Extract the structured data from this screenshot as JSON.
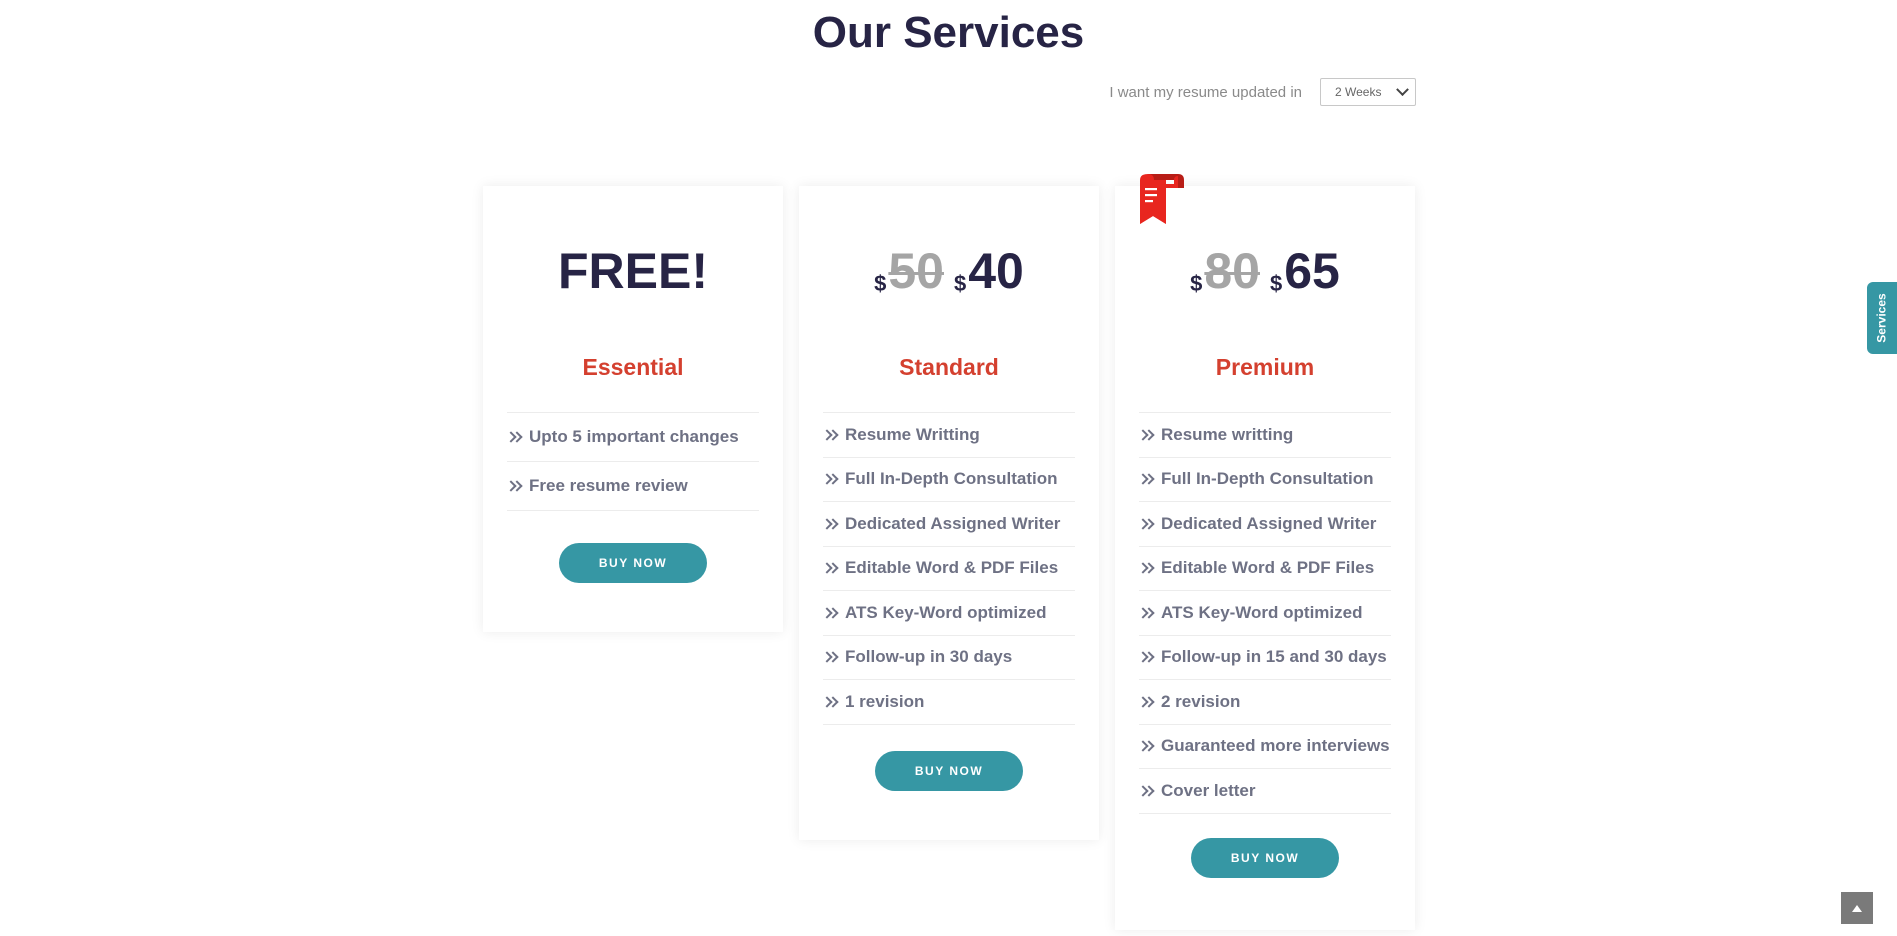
{
  "header": {
    "title": "Our Services"
  },
  "duration": {
    "label": "I want my resume updated in",
    "selected": "2 Weeks"
  },
  "plans": [
    {
      "name": "Essential",
      "price_text": "FREE!",
      "features": [
        "Upto 5 important changes",
        "Free resume review"
      ],
      "button": "BUY NOW"
    },
    {
      "name": "Standard",
      "currency": "$",
      "old_price": "50",
      "price": "40",
      "features": [
        "Resume Writting",
        "Full In-Depth Consultation",
        "Dedicated Assigned Writer",
        "Editable Word & PDF Files",
        "ATS Key-Word optimized",
        "Follow-up in 30 days",
        "1 revision"
      ],
      "button": "BUY NOW"
    },
    {
      "name": "Premium",
      "currency": "$",
      "old_price": "80",
      "price": "65",
      "features": [
        "Resume writting",
        "Full In-Depth Consultation",
        "Dedicated Assigned Writer",
        "Editable Word & PDF Files",
        "ATS Key-Word optimized",
        "Follow-up in 15 and 30 days",
        "2 revision",
        "Guaranteed more interviews",
        "Cover letter"
      ],
      "button": "BUY NOW"
    }
  ],
  "side_tab": {
    "label": "Services"
  },
  "colors": {
    "accent": "#3697a4",
    "plan_name": "#d4402f",
    "heading": "#272445",
    "ribbon": "#e8261f"
  },
  "icons": {
    "feature_bullet": "double-chevron-right-icon",
    "ribbon": "bookmark-ribbon-icon",
    "scroll_top": "arrow-up-icon"
  }
}
